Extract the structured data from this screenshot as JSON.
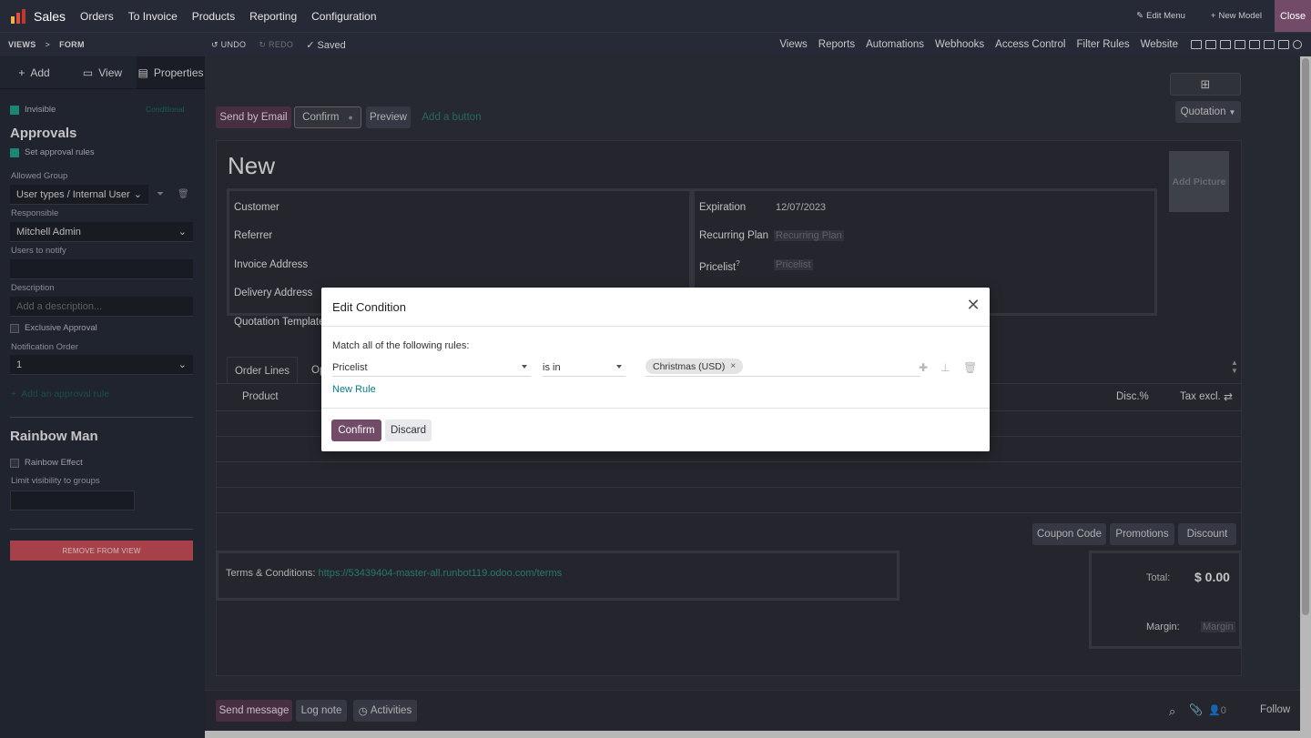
{
  "topnav": {
    "app_name": "Sales",
    "menu": [
      "Orders",
      "To Invoice",
      "Products",
      "Reporting",
      "Configuration"
    ],
    "edit_menu": "Edit Menu",
    "new_model": "New Model",
    "close": "Close"
  },
  "subbar": {
    "crumb_views": "VIEWS",
    "crumb_sep": ">",
    "crumb_form": "FORM",
    "undo": "UNDO",
    "redo": "REDO",
    "saved": "Saved",
    "links": [
      "Views",
      "Reports",
      "Automations",
      "Webhooks",
      "Access Control",
      "Filter Rules",
      "Website"
    ]
  },
  "sidebar": {
    "tabs": {
      "add": "Add",
      "view": "View",
      "properties": "Properties"
    },
    "invisible": "Invisible",
    "conditional": "Conditional",
    "approvals_title": "Approvals",
    "set_approval_rules": "Set approval rules",
    "allowed_group_label": "Allowed Group",
    "allowed_group_value": "User types / Internal User",
    "responsible_label": "Responsible",
    "responsible_value": "Mitchell Admin",
    "users_to_notify_label": "Users to notify",
    "description_label": "Description",
    "description_placeholder": "Add a description...",
    "exclusive_approval": "Exclusive Approval",
    "notification_order_label": "Notification Order",
    "notification_order_value": "1",
    "add_approval_rule": "Add an approval rule",
    "rainbow_title": "Rainbow Man",
    "rainbow_effect": "Rainbow Effect",
    "limit_visibility": "Limit visibility to groups",
    "remove_from_view": "REMOVE FROM VIEW"
  },
  "form": {
    "buttons": {
      "send_by_email": "Send by Email",
      "confirm": "Confirm",
      "preview": "Preview",
      "add_button": "Add a button"
    },
    "status": "Quotation",
    "title": "New",
    "add_picture": "Add Picture",
    "left_fields": [
      "Customer",
      "Referrer",
      "Invoice Address",
      "Delivery Address",
      "Quotation Template"
    ],
    "expiration_label": "Expiration",
    "expiration_value": "12/07/2023",
    "recurring_plan_label": "Recurring Plan",
    "recurring_plan_placeholder": "Recurring Plan",
    "pricelist_label": "Pricelist",
    "pricelist_help": "?",
    "pricelist_placeholder": "Pricelist",
    "tabs": {
      "order_lines": "Order Lines",
      "other": "Op"
    },
    "columns": {
      "product": "Product",
      "disc": "Disc.%",
      "tax_excl": "Tax excl."
    },
    "coupon_code": "Coupon Code",
    "promotions": "Promotions",
    "discount": "Discount",
    "terms_label": "Terms & Conditions:",
    "terms_link": "https://53439404-master-all.runbot119.odoo.com/terms",
    "total_label": "Total:",
    "total_value": "$ 0.00",
    "margin_label": "Margin:",
    "margin_placeholder": "Margin"
  },
  "chatter": {
    "send_message": "Send message",
    "log_note": "Log note",
    "activities": "Activities",
    "attachments_count": "0",
    "follow": "Follow"
  },
  "modal": {
    "title": "Edit Condition",
    "match_text": "Match all of the following rules:",
    "rule_field": "Pricelist",
    "rule_operator": "is in",
    "rule_tag": "Christmas (USD)",
    "new_rule": "New Rule",
    "confirm": "Confirm",
    "discard": "Discard"
  },
  "colors": {
    "brand": "#714b67",
    "link": "#017e84",
    "dark_bg": "#262a36"
  }
}
